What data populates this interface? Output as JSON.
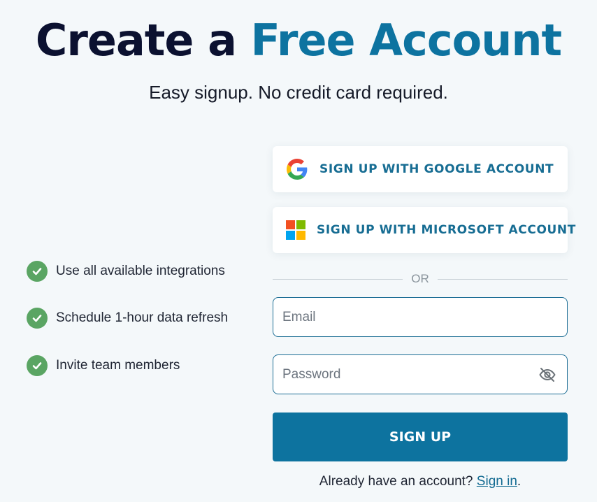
{
  "header": {
    "title_part1": "Create a",
    "title_part2": "Free Account",
    "subtitle": "Easy signup. No credit card required."
  },
  "features": [
    {
      "icon": "check-circle-icon",
      "label": "Use all available integrations"
    },
    {
      "icon": "check-circle-icon",
      "label": "Schedule 1-hour data refresh"
    },
    {
      "icon": "check-circle-icon",
      "label": "Invite team members"
    }
  ],
  "oauth": {
    "google": {
      "icon": "google-logo-icon",
      "label": "SIGN UP WITH GOOGLE ACCOUNT"
    },
    "microsoft": {
      "icon": "microsoft-logo-icon",
      "label": "SIGN UP WITH MICROSOFT ACCOUNT"
    }
  },
  "divider": {
    "label": "OR"
  },
  "form": {
    "email": {
      "placeholder": "Email",
      "value": ""
    },
    "password": {
      "placeholder": "Password",
      "value": "",
      "toggle_icon": "eye-off-icon"
    },
    "submit_label": "SIGN UP"
  },
  "signin": {
    "prompt": "Already have an account?",
    "link_label": "Sign in",
    "suffix": "."
  },
  "colors": {
    "background": "#f4f8fa",
    "title_dark": "#0b1130",
    "accent": "#0d73a0",
    "check_green": "#5aa563",
    "field_border": "#1d6e95"
  }
}
